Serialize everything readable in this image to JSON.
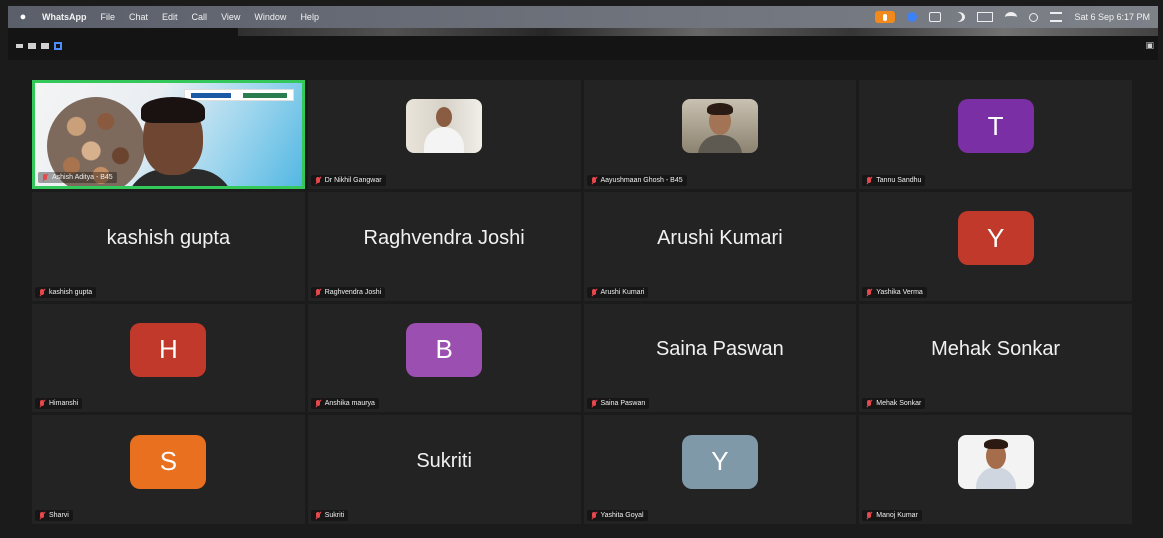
{
  "menubar": {
    "app": "WhatsApp",
    "items": [
      "File",
      "Chat",
      "Edit",
      "Call",
      "View",
      "Window",
      "Help"
    ],
    "clock": "Sat 6 Sep 6:17 PM"
  },
  "colors": {
    "accent_blue": "#2d6df6",
    "active_border": "#34c759",
    "muted_red": "#e5484d",
    "tile_bg": "#232323"
  },
  "tiles": [
    {
      "name": "Ashish Aditya - B45",
      "kind": "video"
    },
    {
      "name": "Dr Nikhil Gangwar",
      "kind": "photo"
    },
    {
      "name": "Aayushmaan Ghosh - B45",
      "kind": "photo"
    },
    {
      "name": "Tannu Sandhu",
      "kind": "letter",
      "letter": "T",
      "color": "#7b2fa5"
    },
    {
      "name": "kashish gupta",
      "kind": "text",
      "display": "kashish gupta"
    },
    {
      "name": "Raghvendra Joshi",
      "kind": "text",
      "display": "Raghvendra Joshi"
    },
    {
      "name": "Arushi Kumari",
      "kind": "text",
      "display": "Arushi Kumari"
    },
    {
      "name": "Yashika Verma",
      "kind": "letter",
      "letter": "Y",
      "color": "#c0392b"
    },
    {
      "name": "Himanshi",
      "kind": "letter",
      "letter": "H",
      "color": "#c0392b"
    },
    {
      "name": "Anshika maurya",
      "kind": "letter",
      "letter": "B",
      "color": "#9b4fb0"
    },
    {
      "name": "Saina Paswan",
      "kind": "text",
      "display": "Saina Paswan"
    },
    {
      "name": "Mehak Sonkar",
      "kind": "text",
      "display": "Mehak Sonkar"
    },
    {
      "name": "Sharvi",
      "kind": "letter",
      "letter": "S",
      "color": "#e8701e"
    },
    {
      "name": "Sukriti",
      "kind": "text",
      "display": "Sukriti"
    },
    {
      "name": "Yashita Goyal",
      "kind": "letter",
      "letter": "Y",
      "color": "#7f99a8"
    },
    {
      "name": "Manoj Kumar",
      "kind": "photo"
    }
  ],
  "more_button": "···"
}
